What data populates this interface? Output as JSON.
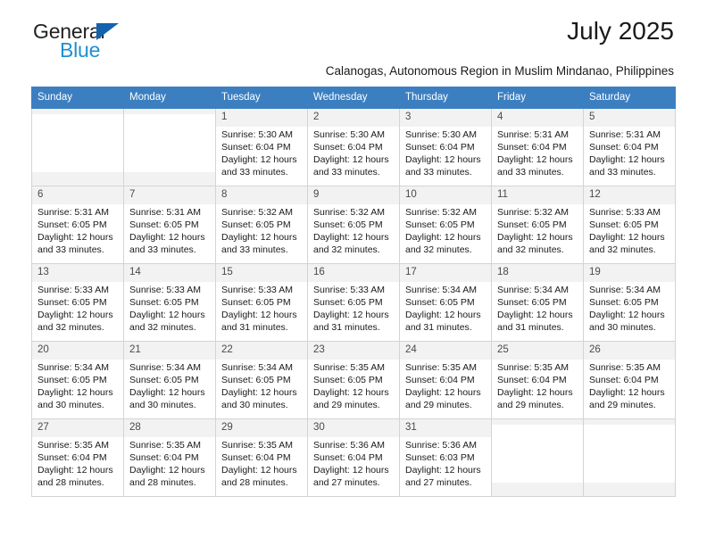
{
  "brand": {
    "name_part1": "General",
    "name_part2": "Blue",
    "triangle_icon": "triangle-icon",
    "accent_dark": "#1262ae",
    "accent_light": "#1d8fd4"
  },
  "header": {
    "month_title": "July 2025",
    "subtitle": "Calanogas, Autonomous Region in Muslim Mindanao, Philippines"
  },
  "theme": {
    "header_bg": "#3c7fc1",
    "header_text": "#ffffff",
    "cell_shade": "#f2f2f2",
    "grid_line": "#d4d4d4"
  },
  "weekdays": [
    "Sunday",
    "Monday",
    "Tuesday",
    "Wednesday",
    "Thursday",
    "Friday",
    "Saturday"
  ],
  "labels": {
    "sunrise_prefix": "Sunrise:",
    "sunset_prefix": "Sunset:",
    "daylight_prefix": "Daylight:"
  },
  "weeks": [
    [
      {
        "day": "",
        "sunrise": "",
        "sunset": "",
        "daylight": ""
      },
      {
        "day": "",
        "sunrise": "",
        "sunset": "",
        "daylight": ""
      },
      {
        "day": "1",
        "sunrise": "Sunrise: 5:30 AM",
        "sunset": "Sunset: 6:04 PM",
        "daylight": "Daylight: 12 hours and 33 minutes."
      },
      {
        "day": "2",
        "sunrise": "Sunrise: 5:30 AM",
        "sunset": "Sunset: 6:04 PM",
        "daylight": "Daylight: 12 hours and 33 minutes."
      },
      {
        "day": "3",
        "sunrise": "Sunrise: 5:30 AM",
        "sunset": "Sunset: 6:04 PM",
        "daylight": "Daylight: 12 hours and 33 minutes."
      },
      {
        "day": "4",
        "sunrise": "Sunrise: 5:31 AM",
        "sunset": "Sunset: 6:04 PM",
        "daylight": "Daylight: 12 hours and 33 minutes."
      },
      {
        "day": "5",
        "sunrise": "Sunrise: 5:31 AM",
        "sunset": "Sunset: 6:04 PM",
        "daylight": "Daylight: 12 hours and 33 minutes."
      }
    ],
    [
      {
        "day": "6",
        "sunrise": "Sunrise: 5:31 AM",
        "sunset": "Sunset: 6:05 PM",
        "daylight": "Daylight: 12 hours and 33 minutes."
      },
      {
        "day": "7",
        "sunrise": "Sunrise: 5:31 AM",
        "sunset": "Sunset: 6:05 PM",
        "daylight": "Daylight: 12 hours and 33 minutes."
      },
      {
        "day": "8",
        "sunrise": "Sunrise: 5:32 AM",
        "sunset": "Sunset: 6:05 PM",
        "daylight": "Daylight: 12 hours and 33 minutes."
      },
      {
        "day": "9",
        "sunrise": "Sunrise: 5:32 AM",
        "sunset": "Sunset: 6:05 PM",
        "daylight": "Daylight: 12 hours and 32 minutes."
      },
      {
        "day": "10",
        "sunrise": "Sunrise: 5:32 AM",
        "sunset": "Sunset: 6:05 PM",
        "daylight": "Daylight: 12 hours and 32 minutes."
      },
      {
        "day": "11",
        "sunrise": "Sunrise: 5:32 AM",
        "sunset": "Sunset: 6:05 PM",
        "daylight": "Daylight: 12 hours and 32 minutes."
      },
      {
        "day": "12",
        "sunrise": "Sunrise: 5:33 AM",
        "sunset": "Sunset: 6:05 PM",
        "daylight": "Daylight: 12 hours and 32 minutes."
      }
    ],
    [
      {
        "day": "13",
        "sunrise": "Sunrise: 5:33 AM",
        "sunset": "Sunset: 6:05 PM",
        "daylight": "Daylight: 12 hours and 32 minutes."
      },
      {
        "day": "14",
        "sunrise": "Sunrise: 5:33 AM",
        "sunset": "Sunset: 6:05 PM",
        "daylight": "Daylight: 12 hours and 32 minutes."
      },
      {
        "day": "15",
        "sunrise": "Sunrise: 5:33 AM",
        "sunset": "Sunset: 6:05 PM",
        "daylight": "Daylight: 12 hours and 31 minutes."
      },
      {
        "day": "16",
        "sunrise": "Sunrise: 5:33 AM",
        "sunset": "Sunset: 6:05 PM",
        "daylight": "Daylight: 12 hours and 31 minutes."
      },
      {
        "day": "17",
        "sunrise": "Sunrise: 5:34 AM",
        "sunset": "Sunset: 6:05 PM",
        "daylight": "Daylight: 12 hours and 31 minutes."
      },
      {
        "day": "18",
        "sunrise": "Sunrise: 5:34 AM",
        "sunset": "Sunset: 6:05 PM",
        "daylight": "Daylight: 12 hours and 31 minutes."
      },
      {
        "day": "19",
        "sunrise": "Sunrise: 5:34 AM",
        "sunset": "Sunset: 6:05 PM",
        "daylight": "Daylight: 12 hours and 30 minutes."
      }
    ],
    [
      {
        "day": "20",
        "sunrise": "Sunrise: 5:34 AM",
        "sunset": "Sunset: 6:05 PM",
        "daylight": "Daylight: 12 hours and 30 minutes."
      },
      {
        "day": "21",
        "sunrise": "Sunrise: 5:34 AM",
        "sunset": "Sunset: 6:05 PM",
        "daylight": "Daylight: 12 hours and 30 minutes."
      },
      {
        "day": "22",
        "sunrise": "Sunrise: 5:34 AM",
        "sunset": "Sunset: 6:05 PM",
        "daylight": "Daylight: 12 hours and 30 minutes."
      },
      {
        "day": "23",
        "sunrise": "Sunrise: 5:35 AM",
        "sunset": "Sunset: 6:05 PM",
        "daylight": "Daylight: 12 hours and 29 minutes."
      },
      {
        "day": "24",
        "sunrise": "Sunrise: 5:35 AM",
        "sunset": "Sunset: 6:04 PM",
        "daylight": "Daylight: 12 hours and 29 minutes."
      },
      {
        "day": "25",
        "sunrise": "Sunrise: 5:35 AM",
        "sunset": "Sunset: 6:04 PM",
        "daylight": "Daylight: 12 hours and 29 minutes."
      },
      {
        "day": "26",
        "sunrise": "Sunrise: 5:35 AM",
        "sunset": "Sunset: 6:04 PM",
        "daylight": "Daylight: 12 hours and 29 minutes."
      }
    ],
    [
      {
        "day": "27",
        "sunrise": "Sunrise: 5:35 AM",
        "sunset": "Sunset: 6:04 PM",
        "daylight": "Daylight: 12 hours and 28 minutes."
      },
      {
        "day": "28",
        "sunrise": "Sunrise: 5:35 AM",
        "sunset": "Sunset: 6:04 PM",
        "daylight": "Daylight: 12 hours and 28 minutes."
      },
      {
        "day": "29",
        "sunrise": "Sunrise: 5:35 AM",
        "sunset": "Sunset: 6:04 PM",
        "daylight": "Daylight: 12 hours and 28 minutes."
      },
      {
        "day": "30",
        "sunrise": "Sunrise: 5:36 AM",
        "sunset": "Sunset: 6:04 PM",
        "daylight": "Daylight: 12 hours and 27 minutes."
      },
      {
        "day": "31",
        "sunrise": "Sunrise: 5:36 AM",
        "sunset": "Sunset: 6:03 PM",
        "daylight": "Daylight: 12 hours and 27 minutes."
      },
      {
        "day": "",
        "sunrise": "",
        "sunset": "",
        "daylight": ""
      },
      {
        "day": "",
        "sunrise": "",
        "sunset": "",
        "daylight": ""
      }
    ]
  ]
}
